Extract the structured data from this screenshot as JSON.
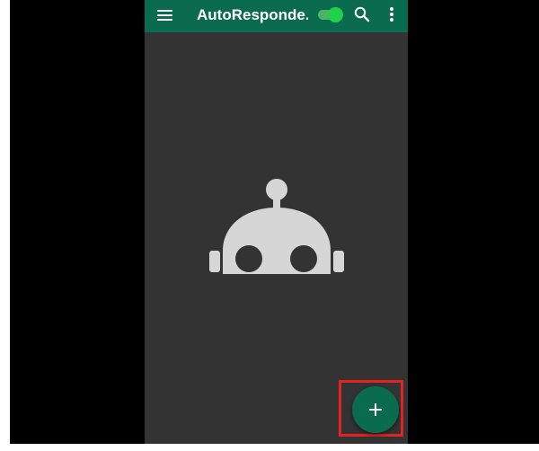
{
  "app": {
    "title": "AutoResponde...",
    "colors": {
      "appbar": "#0b6b4f",
      "background": "#333333",
      "toggle_on": "#22d14a",
      "fab": "#0b6b4f",
      "highlight": "#e32322"
    }
  },
  "toolbar": {
    "menu_icon": "hamburger-menu-icon",
    "toggle_state": "on",
    "search_icon": "search-icon",
    "more_icon": "more-vert-icon"
  },
  "empty_state": {
    "icon": "robot-icon"
  },
  "fab": {
    "icon": "plus-icon",
    "highlighted": true
  }
}
